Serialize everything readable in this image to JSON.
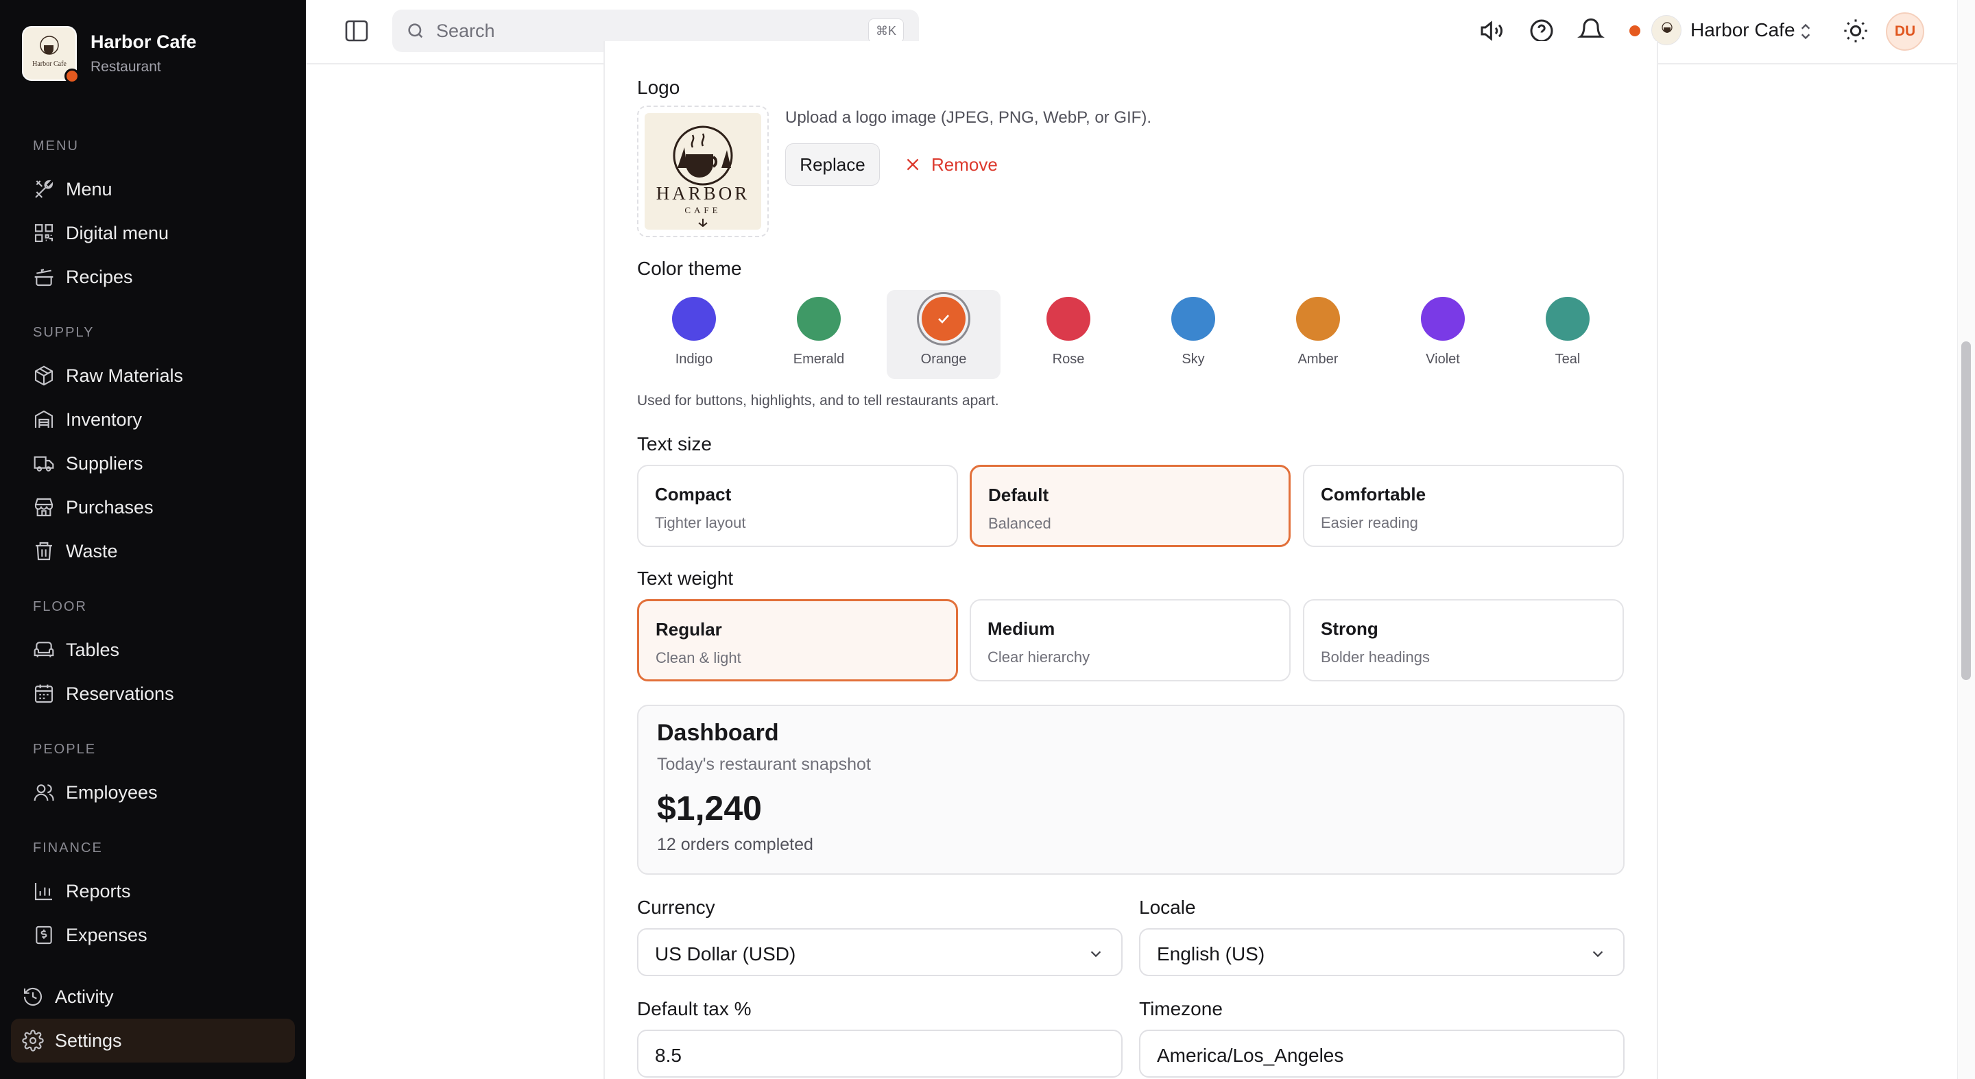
{
  "brand": {
    "name": "Harbor Cafe",
    "subtitle": "Restaurant"
  },
  "sidebar": {
    "sections": [
      {
        "title": "MENU",
        "items": [
          {
            "label": "Menu",
            "icon": "utensils-icon"
          },
          {
            "label": "Digital menu",
            "icon": "qr-code-icon"
          },
          {
            "label": "Recipes",
            "icon": "cooking-pot-icon"
          }
        ]
      },
      {
        "title": "SUPPLY",
        "items": [
          {
            "label": "Raw Materials",
            "icon": "package-icon"
          },
          {
            "label": "Inventory",
            "icon": "warehouse-icon"
          },
          {
            "label": "Suppliers",
            "icon": "truck-icon"
          },
          {
            "label": "Purchases",
            "icon": "store-icon"
          },
          {
            "label": "Waste",
            "icon": "trash-icon"
          }
        ]
      },
      {
        "title": "FLOOR",
        "items": [
          {
            "label": "Tables",
            "icon": "sofa-icon"
          },
          {
            "label": "Reservations",
            "icon": "calendar-icon"
          }
        ]
      },
      {
        "title": "PEOPLE",
        "items": [
          {
            "label": "Employees",
            "icon": "users-icon"
          }
        ]
      },
      {
        "title": "FINANCE",
        "items": [
          {
            "label": "Reports",
            "icon": "bar-chart-icon"
          },
          {
            "label": "Expenses",
            "icon": "receipt-icon"
          }
        ]
      }
    ],
    "bottom": [
      {
        "label": "Activity",
        "icon": "history-icon"
      },
      {
        "label": "Settings",
        "icon": "gear-icon",
        "active": true
      }
    ]
  },
  "topbar": {
    "search_placeholder": "Search",
    "search_shortcut": "⌘K",
    "org_name": "Harbor Cafe",
    "user_initials": "DU"
  },
  "logo": {
    "label": "Logo",
    "help": "Upload a logo image (JPEG, PNG, WebP, or GIF).",
    "replace_label": "Replace",
    "remove_label": "Remove",
    "image_text": "HARBOR",
    "image_subtext": "CAFE"
  },
  "theme": {
    "label": "Color theme",
    "selected": "Orange",
    "swatches": [
      {
        "name": "Indigo",
        "color": "#5046e5"
      },
      {
        "name": "Emerald",
        "color": "#3f9966"
      },
      {
        "name": "Orange",
        "color": "#e5612a"
      },
      {
        "name": "Rose",
        "color": "#db3a4b"
      },
      {
        "name": "Sky",
        "color": "#3b86cf"
      },
      {
        "name": "Amber",
        "color": "#d9842c"
      },
      {
        "name": "Violet",
        "color": "#7a3ae6"
      },
      {
        "name": "Teal",
        "color": "#3d978a"
      }
    ],
    "help": "Used for buttons, highlights, and to tell restaurants apart."
  },
  "text_size": {
    "label": "Text size",
    "selected": "Default",
    "options": [
      {
        "title": "Compact",
        "subtitle": "Tighter layout"
      },
      {
        "title": "Default",
        "subtitle": "Balanced"
      },
      {
        "title": "Comfortable",
        "subtitle": "Easier reading"
      }
    ]
  },
  "text_weight": {
    "label": "Text weight",
    "selected": "Regular",
    "options": [
      {
        "title": "Regular",
        "subtitle": "Clean & light"
      },
      {
        "title": "Medium",
        "subtitle": "Clear hierarchy"
      },
      {
        "title": "Strong",
        "subtitle": "Bolder headings"
      }
    ]
  },
  "preview": {
    "title": "Dashboard",
    "subtitle": "Today's restaurant snapshot",
    "amount": "$1,240",
    "orders": "12 orders completed"
  },
  "fields": {
    "currency_label": "Currency",
    "currency_value": "US Dollar (USD)",
    "locale_label": "Locale",
    "locale_value": "English (US)",
    "tax_label": "Default tax %",
    "tax_value": "8.5",
    "timezone_label": "Timezone",
    "timezone_value": "America/Los_Angeles"
  },
  "colors": {
    "accent": "#e2703a",
    "danger": "#dc3a2e",
    "sidebar_bg": "#0c0c0e"
  }
}
